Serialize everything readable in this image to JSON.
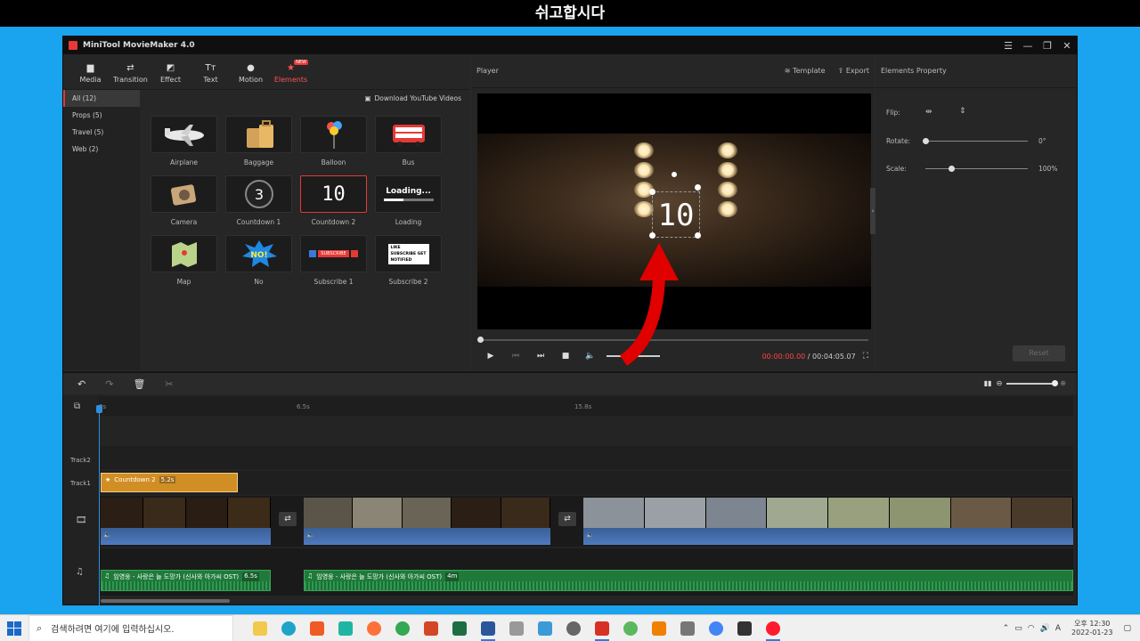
{
  "caption": "쉬고합시다",
  "app": {
    "title": "MiniTool MovieMaker 4.0"
  },
  "toolbar": [
    {
      "label": "Media",
      "icon": "folder-icon"
    },
    {
      "label": "Transition",
      "icon": "transition-icon"
    },
    {
      "label": "Effect",
      "icon": "effect-icon"
    },
    {
      "label": "Text",
      "icon": "text-icon"
    },
    {
      "label": "Motion",
      "icon": "motion-icon"
    },
    {
      "label": "Elements",
      "icon": "elements-icon",
      "badge": "NEW"
    }
  ],
  "categories": [
    "All (12)",
    "Props (5)",
    "Travel (5)",
    "Web (2)"
  ],
  "download_link": "Download YouTube Videos",
  "elements": [
    {
      "label": "Airplane",
      "icon": "airplane-icon"
    },
    {
      "label": "Baggage",
      "icon": "baggage-icon"
    },
    {
      "label": "Balloon",
      "icon": "balloon-icon"
    },
    {
      "label": "Bus",
      "icon": "bus-icon"
    },
    {
      "label": "Camera",
      "icon": "camera-icon"
    },
    {
      "label": "Countdown 1",
      "icon": "countdown-icon",
      "thumb_text": "3"
    },
    {
      "label": "Countdown 2",
      "icon": "countdown-icon",
      "thumb_text": "10"
    },
    {
      "label": "Loading",
      "icon": "loading-icon",
      "thumb_text": "Loading..."
    },
    {
      "label": "Map",
      "icon": "map-icon"
    },
    {
      "label": "No",
      "icon": "no-icon",
      "thumb_text": "NO!"
    },
    {
      "label": "Subscribe 1",
      "icon": "subscribe-icon",
      "thumb_text": "SUBSCRIBE"
    },
    {
      "label": "Subscribe 2",
      "icon": "subscribe-icon",
      "thumb_text": "LIKE SUBSCRIBE GET NOTIFIED"
    }
  ],
  "player": {
    "title": "Player",
    "template": "Template",
    "export": "Export",
    "overlay_text": "10",
    "time_current": "00:00:00.00",
    "time_total": "/ 00:04:05.07"
  },
  "properties": {
    "title": "Elements Property",
    "flip_label": "Flip:",
    "rotate_label": "Rotate:",
    "rotate_value": "0°",
    "scale_label": "Scale:",
    "scale_value": "100%",
    "rotate_level": 0,
    "scale_level": 0.25,
    "reset": "Reset"
  },
  "timeline": {
    "ruler_ticks": [
      "0s",
      "6.5s",
      "15.8s"
    ],
    "tracks": [
      "Track2",
      "Track1"
    ],
    "element_clip": {
      "label": "Countdown 2",
      "duration": "5.2s"
    },
    "audio_clips": [
      {
        "label": "임영웅 - 사랑은 늘 도망가 (신사와 아가씨 OST)",
        "duration": "6.5s"
      },
      {
        "label": "임영웅 - 사랑은 늘 도망가 (신사와 아가씨 OST)",
        "duration": "4m"
      }
    ]
  },
  "taskbar": {
    "search_placeholder": "검색하려면 여기에 입력하십시오.",
    "ime": "A",
    "time": "오후 12:30",
    "date": "2022-01-23"
  },
  "colors": {
    "accent": "#e53935",
    "element_clip": "#d18e24",
    "audio_clip": "#1f7a3a",
    "frame_blue": "#1aa3ee"
  }
}
